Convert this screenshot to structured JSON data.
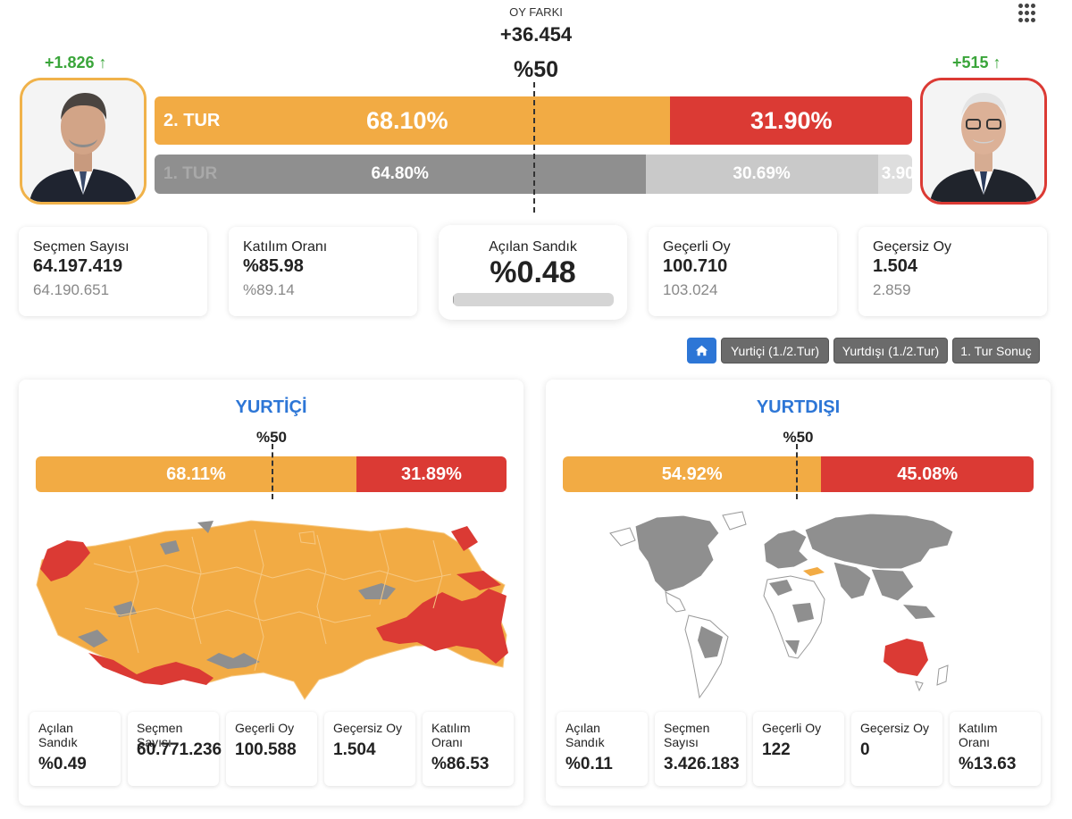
{
  "header": {
    "oy_farki_label": "OY FARKI",
    "oy_farki_value": "+36.454",
    "half_mark": "%50"
  },
  "candidates": {
    "left": {
      "gain": "+1.826 ↑",
      "color": "#f2ab44"
    },
    "right": {
      "gain": "+515 ↑",
      "color": "#db3a34"
    }
  },
  "round2": {
    "label": "2. TUR",
    "left_pct": "68.10%",
    "right_pct": "31.90%",
    "left_share": 68.1,
    "right_share": 31.9
  },
  "round1": {
    "label": "1. TUR",
    "left_pct": "64.80%",
    "right_pct": "30.69%",
    "other_pct": "3.90",
    "left_share": 64.8,
    "right_share": 30.69,
    "other_share": 4.51
  },
  "stats": {
    "secmen": {
      "label": "Seçmen Sayısı",
      "value": "64.197.419",
      "prev": "64.190.651"
    },
    "katilim": {
      "label": "Katılım Oranı",
      "value": "%85.98",
      "prev": "%89.14"
    },
    "acilan": {
      "label": "Açılan Sandık",
      "value": "%0.48",
      "progress": 0.48
    },
    "gecerli": {
      "label": "Geçerli Oy",
      "value": "100.710",
      "prev": "103.024"
    },
    "gecersiz": {
      "label": "Geçersiz Oy",
      "value": "1.504",
      "prev": "2.859"
    }
  },
  "filters": {
    "home_icon": "home-icon",
    "yurtici": "Yurtiçi (1./2.Tur)",
    "yurtdisi": "Yurtdışı (1./2.Tur)",
    "tur1": "1. Tur Sonuç"
  },
  "panels": {
    "yurtici": {
      "title": "YURTİÇİ",
      "half_mark": "%50",
      "left_pct": "68.11%",
      "right_pct": "31.89%",
      "left_share": 68.11,
      "cards": {
        "acilan": {
          "label": "Açılan Sandık",
          "value": "%0.49"
        },
        "secmen": {
          "label": "Seçmen Sayısı",
          "value": "60.771.236"
        },
        "gecerli": {
          "label": "Geçerli Oy",
          "value": "100.588"
        },
        "gecersiz": {
          "label": "Geçersiz Oy",
          "value": "1.504"
        },
        "katilim": {
          "label": "Katılım Oranı",
          "value": "%86.53"
        }
      }
    },
    "yurtdisi": {
      "title": "YURTDIŞI",
      "half_mark": "%50",
      "left_pct": "54.92%",
      "right_pct": "45.08%",
      "left_share": 54.92,
      "cards": {
        "acilan": {
          "label": "Açılan Sandık",
          "value": "%0.11"
        },
        "secmen": {
          "label": "Seçmen Sayısı",
          "value": "3.426.183"
        },
        "gecerli": {
          "label": "Geçerli Oy",
          "value": "122"
        },
        "gecersiz": {
          "label": "Geçersiz Oy",
          "value": "0"
        },
        "katilim": {
          "label": "Katılım Oranı",
          "value": "%13.63"
        }
      }
    }
  },
  "colors": {
    "orange": "#f2ab44",
    "red": "#db3a34",
    "gray": "#8f8f8f",
    "light_gray": "#c9c9c9",
    "accent_blue": "#2d76d6"
  }
}
